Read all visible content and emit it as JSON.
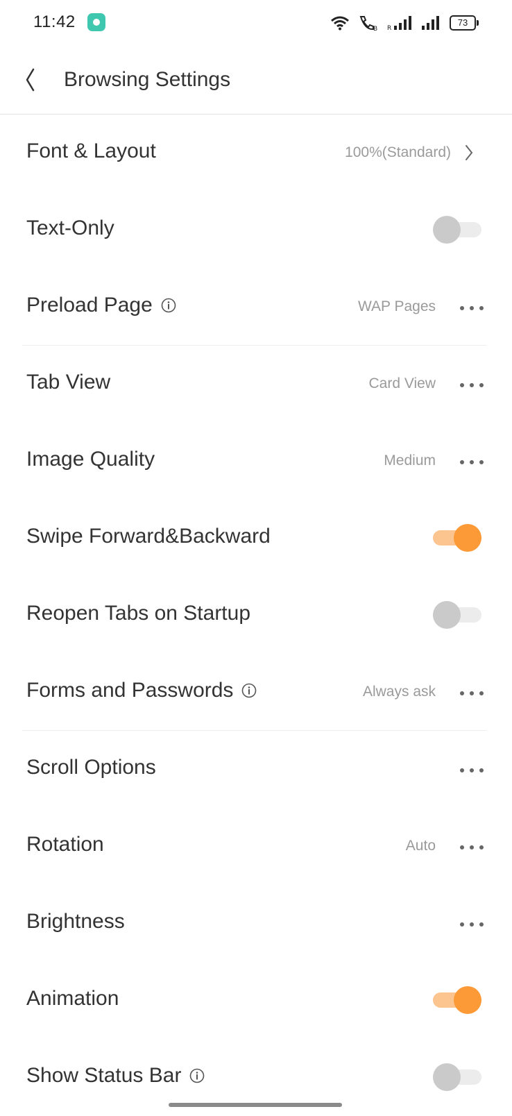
{
  "status_bar": {
    "time": "11:42",
    "app_icon": "app-notification-icon",
    "icons": [
      "wifi-icon",
      "call-icon",
      "signal-icon",
      "signal-icon"
    ],
    "roaming_label": "R",
    "battery": "73"
  },
  "header": {
    "back_icon": "chevron-left-icon",
    "title": "Browsing Settings"
  },
  "colors": {
    "accent": "#fb9a36",
    "accent_track": "#fcc48f",
    "toggle_off_knob": "#cacaca",
    "toggle_off_track": "#ececec",
    "text_primary": "#333333",
    "text_secondary": "#9a9a9a"
  },
  "settings": [
    {
      "label": "Font & Layout",
      "value": "100%(Standard)",
      "control": "chevron"
    },
    {
      "label": "Text-Only",
      "control": "toggle",
      "on": false
    },
    {
      "label": "Preload Page",
      "info": true,
      "value": "WAP Pages",
      "control": "more"
    },
    {
      "label": "Tab View",
      "value": "Card View",
      "control": "more"
    },
    {
      "label": "Image Quality",
      "value": "Medium",
      "control": "more"
    },
    {
      "label": "Swipe Forward&Backward",
      "control": "toggle",
      "on": true
    },
    {
      "label": "Reopen Tabs on Startup",
      "control": "toggle",
      "on": false
    },
    {
      "label": "Forms and Passwords",
      "info": true,
      "value": "Always ask",
      "control": "more"
    },
    {
      "label": "Scroll Options",
      "value": "",
      "control": "more"
    },
    {
      "label": "Rotation",
      "value": "Auto",
      "control": "more"
    },
    {
      "label": "Brightness",
      "value": "",
      "control": "more"
    },
    {
      "label": "Animation",
      "control": "toggle",
      "on": true
    },
    {
      "label": "Show Status Bar",
      "info": true,
      "control": "toggle",
      "on": false
    }
  ]
}
